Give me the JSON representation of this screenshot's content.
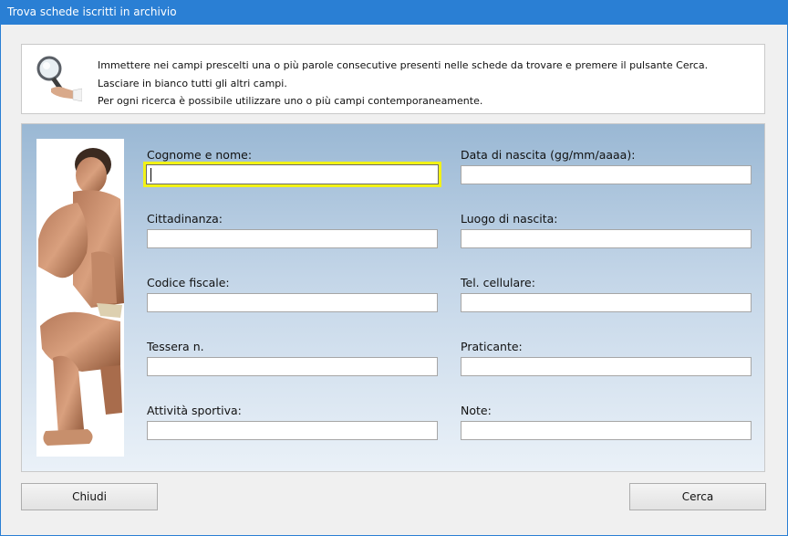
{
  "window": {
    "title": "Trova schede iscritti in archivio"
  },
  "info": {
    "lines": [
      "Immettere nei campi prescelti una o più parole consecutive presenti nelle schede da trovare e premere il pulsante Cerca.",
      "Lasciare in bianco tutti gli altri campi.",
      "Per ogni ricerca è possibile utilizzare uno o più campi contemporaneamente."
    ]
  },
  "fields": {
    "cognome_nome": {
      "label": "Cognome e nome:",
      "value": ""
    },
    "data_nascita": {
      "label": "Data di nascita (gg/mm/aaaa):",
      "value": ""
    },
    "cittadinanza": {
      "label": "Cittadinanza:",
      "value": ""
    },
    "luogo_nascita": {
      "label": "Luogo di nascita:",
      "value": ""
    },
    "codice_fiscale": {
      "label": "Codice fiscale:",
      "value": ""
    },
    "tel_cellulare": {
      "label": "Tel. cellulare:",
      "value": ""
    },
    "tessera": {
      "label": "Tessera n.",
      "value": ""
    },
    "praticante": {
      "label": "Praticante:",
      "value": ""
    },
    "attivita_sportiva": {
      "label": "Attività sportiva:",
      "value": ""
    },
    "note": {
      "label": "Note:",
      "value": ""
    }
  },
  "buttons": {
    "close": "Chiudi",
    "search": "Cerca"
  },
  "colors": {
    "titlebar": "#2a7fd4",
    "focus_border": "#f2f217"
  }
}
